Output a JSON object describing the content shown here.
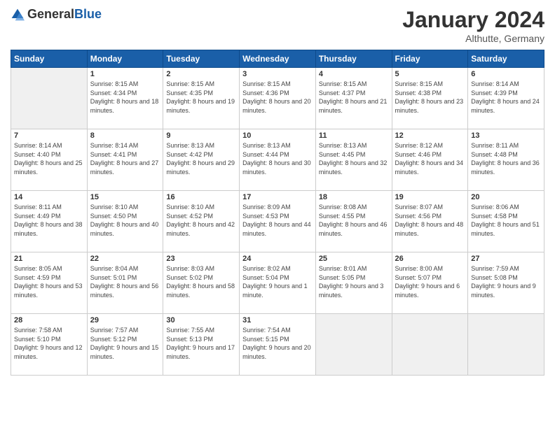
{
  "logo": {
    "general": "General",
    "blue": "Blue"
  },
  "title": {
    "month": "January 2024",
    "location": "Althutte, Germany"
  },
  "weekdays": [
    "Sunday",
    "Monday",
    "Tuesday",
    "Wednesday",
    "Thursday",
    "Friday",
    "Saturday"
  ],
  "weeks": [
    [
      {
        "day": "",
        "sunrise": "",
        "sunset": "",
        "daylight": "",
        "empty": true
      },
      {
        "day": "1",
        "sunrise": "Sunrise: 8:15 AM",
        "sunset": "Sunset: 4:34 PM",
        "daylight": "Daylight: 8 hours and 18 minutes."
      },
      {
        "day": "2",
        "sunrise": "Sunrise: 8:15 AM",
        "sunset": "Sunset: 4:35 PM",
        "daylight": "Daylight: 8 hours and 19 minutes."
      },
      {
        "day": "3",
        "sunrise": "Sunrise: 8:15 AM",
        "sunset": "Sunset: 4:36 PM",
        "daylight": "Daylight: 8 hours and 20 minutes."
      },
      {
        "day": "4",
        "sunrise": "Sunrise: 8:15 AM",
        "sunset": "Sunset: 4:37 PM",
        "daylight": "Daylight: 8 hours and 21 minutes."
      },
      {
        "day": "5",
        "sunrise": "Sunrise: 8:15 AM",
        "sunset": "Sunset: 4:38 PM",
        "daylight": "Daylight: 8 hours and 23 minutes."
      },
      {
        "day": "6",
        "sunrise": "Sunrise: 8:14 AM",
        "sunset": "Sunset: 4:39 PM",
        "daylight": "Daylight: 8 hours and 24 minutes."
      }
    ],
    [
      {
        "day": "7",
        "sunrise": "Sunrise: 8:14 AM",
        "sunset": "Sunset: 4:40 PM",
        "daylight": "Daylight: 8 hours and 25 minutes."
      },
      {
        "day": "8",
        "sunrise": "Sunrise: 8:14 AM",
        "sunset": "Sunset: 4:41 PM",
        "daylight": "Daylight: 8 hours and 27 minutes."
      },
      {
        "day": "9",
        "sunrise": "Sunrise: 8:13 AM",
        "sunset": "Sunset: 4:42 PM",
        "daylight": "Daylight: 8 hours and 29 minutes."
      },
      {
        "day": "10",
        "sunrise": "Sunrise: 8:13 AM",
        "sunset": "Sunset: 4:44 PM",
        "daylight": "Daylight: 8 hours and 30 minutes."
      },
      {
        "day": "11",
        "sunrise": "Sunrise: 8:13 AM",
        "sunset": "Sunset: 4:45 PM",
        "daylight": "Daylight: 8 hours and 32 minutes."
      },
      {
        "day": "12",
        "sunrise": "Sunrise: 8:12 AM",
        "sunset": "Sunset: 4:46 PM",
        "daylight": "Daylight: 8 hours and 34 minutes."
      },
      {
        "day": "13",
        "sunrise": "Sunrise: 8:11 AM",
        "sunset": "Sunset: 4:48 PM",
        "daylight": "Daylight: 8 hours and 36 minutes."
      }
    ],
    [
      {
        "day": "14",
        "sunrise": "Sunrise: 8:11 AM",
        "sunset": "Sunset: 4:49 PM",
        "daylight": "Daylight: 8 hours and 38 minutes."
      },
      {
        "day": "15",
        "sunrise": "Sunrise: 8:10 AM",
        "sunset": "Sunset: 4:50 PM",
        "daylight": "Daylight: 8 hours and 40 minutes."
      },
      {
        "day": "16",
        "sunrise": "Sunrise: 8:10 AM",
        "sunset": "Sunset: 4:52 PM",
        "daylight": "Daylight: 8 hours and 42 minutes."
      },
      {
        "day": "17",
        "sunrise": "Sunrise: 8:09 AM",
        "sunset": "Sunset: 4:53 PM",
        "daylight": "Daylight: 8 hours and 44 minutes."
      },
      {
        "day": "18",
        "sunrise": "Sunrise: 8:08 AM",
        "sunset": "Sunset: 4:55 PM",
        "daylight": "Daylight: 8 hours and 46 minutes."
      },
      {
        "day": "19",
        "sunrise": "Sunrise: 8:07 AM",
        "sunset": "Sunset: 4:56 PM",
        "daylight": "Daylight: 8 hours and 48 minutes."
      },
      {
        "day": "20",
        "sunrise": "Sunrise: 8:06 AM",
        "sunset": "Sunset: 4:58 PM",
        "daylight": "Daylight: 8 hours and 51 minutes."
      }
    ],
    [
      {
        "day": "21",
        "sunrise": "Sunrise: 8:05 AM",
        "sunset": "Sunset: 4:59 PM",
        "daylight": "Daylight: 8 hours and 53 minutes."
      },
      {
        "day": "22",
        "sunrise": "Sunrise: 8:04 AM",
        "sunset": "Sunset: 5:01 PM",
        "daylight": "Daylight: 8 hours and 56 minutes."
      },
      {
        "day": "23",
        "sunrise": "Sunrise: 8:03 AM",
        "sunset": "Sunset: 5:02 PM",
        "daylight": "Daylight: 8 hours and 58 minutes."
      },
      {
        "day": "24",
        "sunrise": "Sunrise: 8:02 AM",
        "sunset": "Sunset: 5:04 PM",
        "daylight": "Daylight: 9 hours and 1 minute."
      },
      {
        "day": "25",
        "sunrise": "Sunrise: 8:01 AM",
        "sunset": "Sunset: 5:05 PM",
        "daylight": "Daylight: 9 hours and 3 minutes."
      },
      {
        "day": "26",
        "sunrise": "Sunrise: 8:00 AM",
        "sunset": "Sunset: 5:07 PM",
        "daylight": "Daylight: 9 hours and 6 minutes."
      },
      {
        "day": "27",
        "sunrise": "Sunrise: 7:59 AM",
        "sunset": "Sunset: 5:08 PM",
        "daylight": "Daylight: 9 hours and 9 minutes."
      }
    ],
    [
      {
        "day": "28",
        "sunrise": "Sunrise: 7:58 AM",
        "sunset": "Sunset: 5:10 PM",
        "daylight": "Daylight: 9 hours and 12 minutes."
      },
      {
        "day": "29",
        "sunrise": "Sunrise: 7:57 AM",
        "sunset": "Sunset: 5:12 PM",
        "daylight": "Daylight: 9 hours and 15 minutes."
      },
      {
        "day": "30",
        "sunrise": "Sunrise: 7:55 AM",
        "sunset": "Sunset: 5:13 PM",
        "daylight": "Daylight: 9 hours and 17 minutes."
      },
      {
        "day": "31",
        "sunrise": "Sunrise: 7:54 AM",
        "sunset": "Sunset: 5:15 PM",
        "daylight": "Daylight: 9 hours and 20 minutes."
      },
      {
        "day": "",
        "sunrise": "",
        "sunset": "",
        "daylight": "",
        "empty": true
      },
      {
        "day": "",
        "sunrise": "",
        "sunset": "",
        "daylight": "",
        "empty": true
      },
      {
        "day": "",
        "sunrise": "",
        "sunset": "",
        "daylight": "",
        "empty": true
      }
    ]
  ]
}
